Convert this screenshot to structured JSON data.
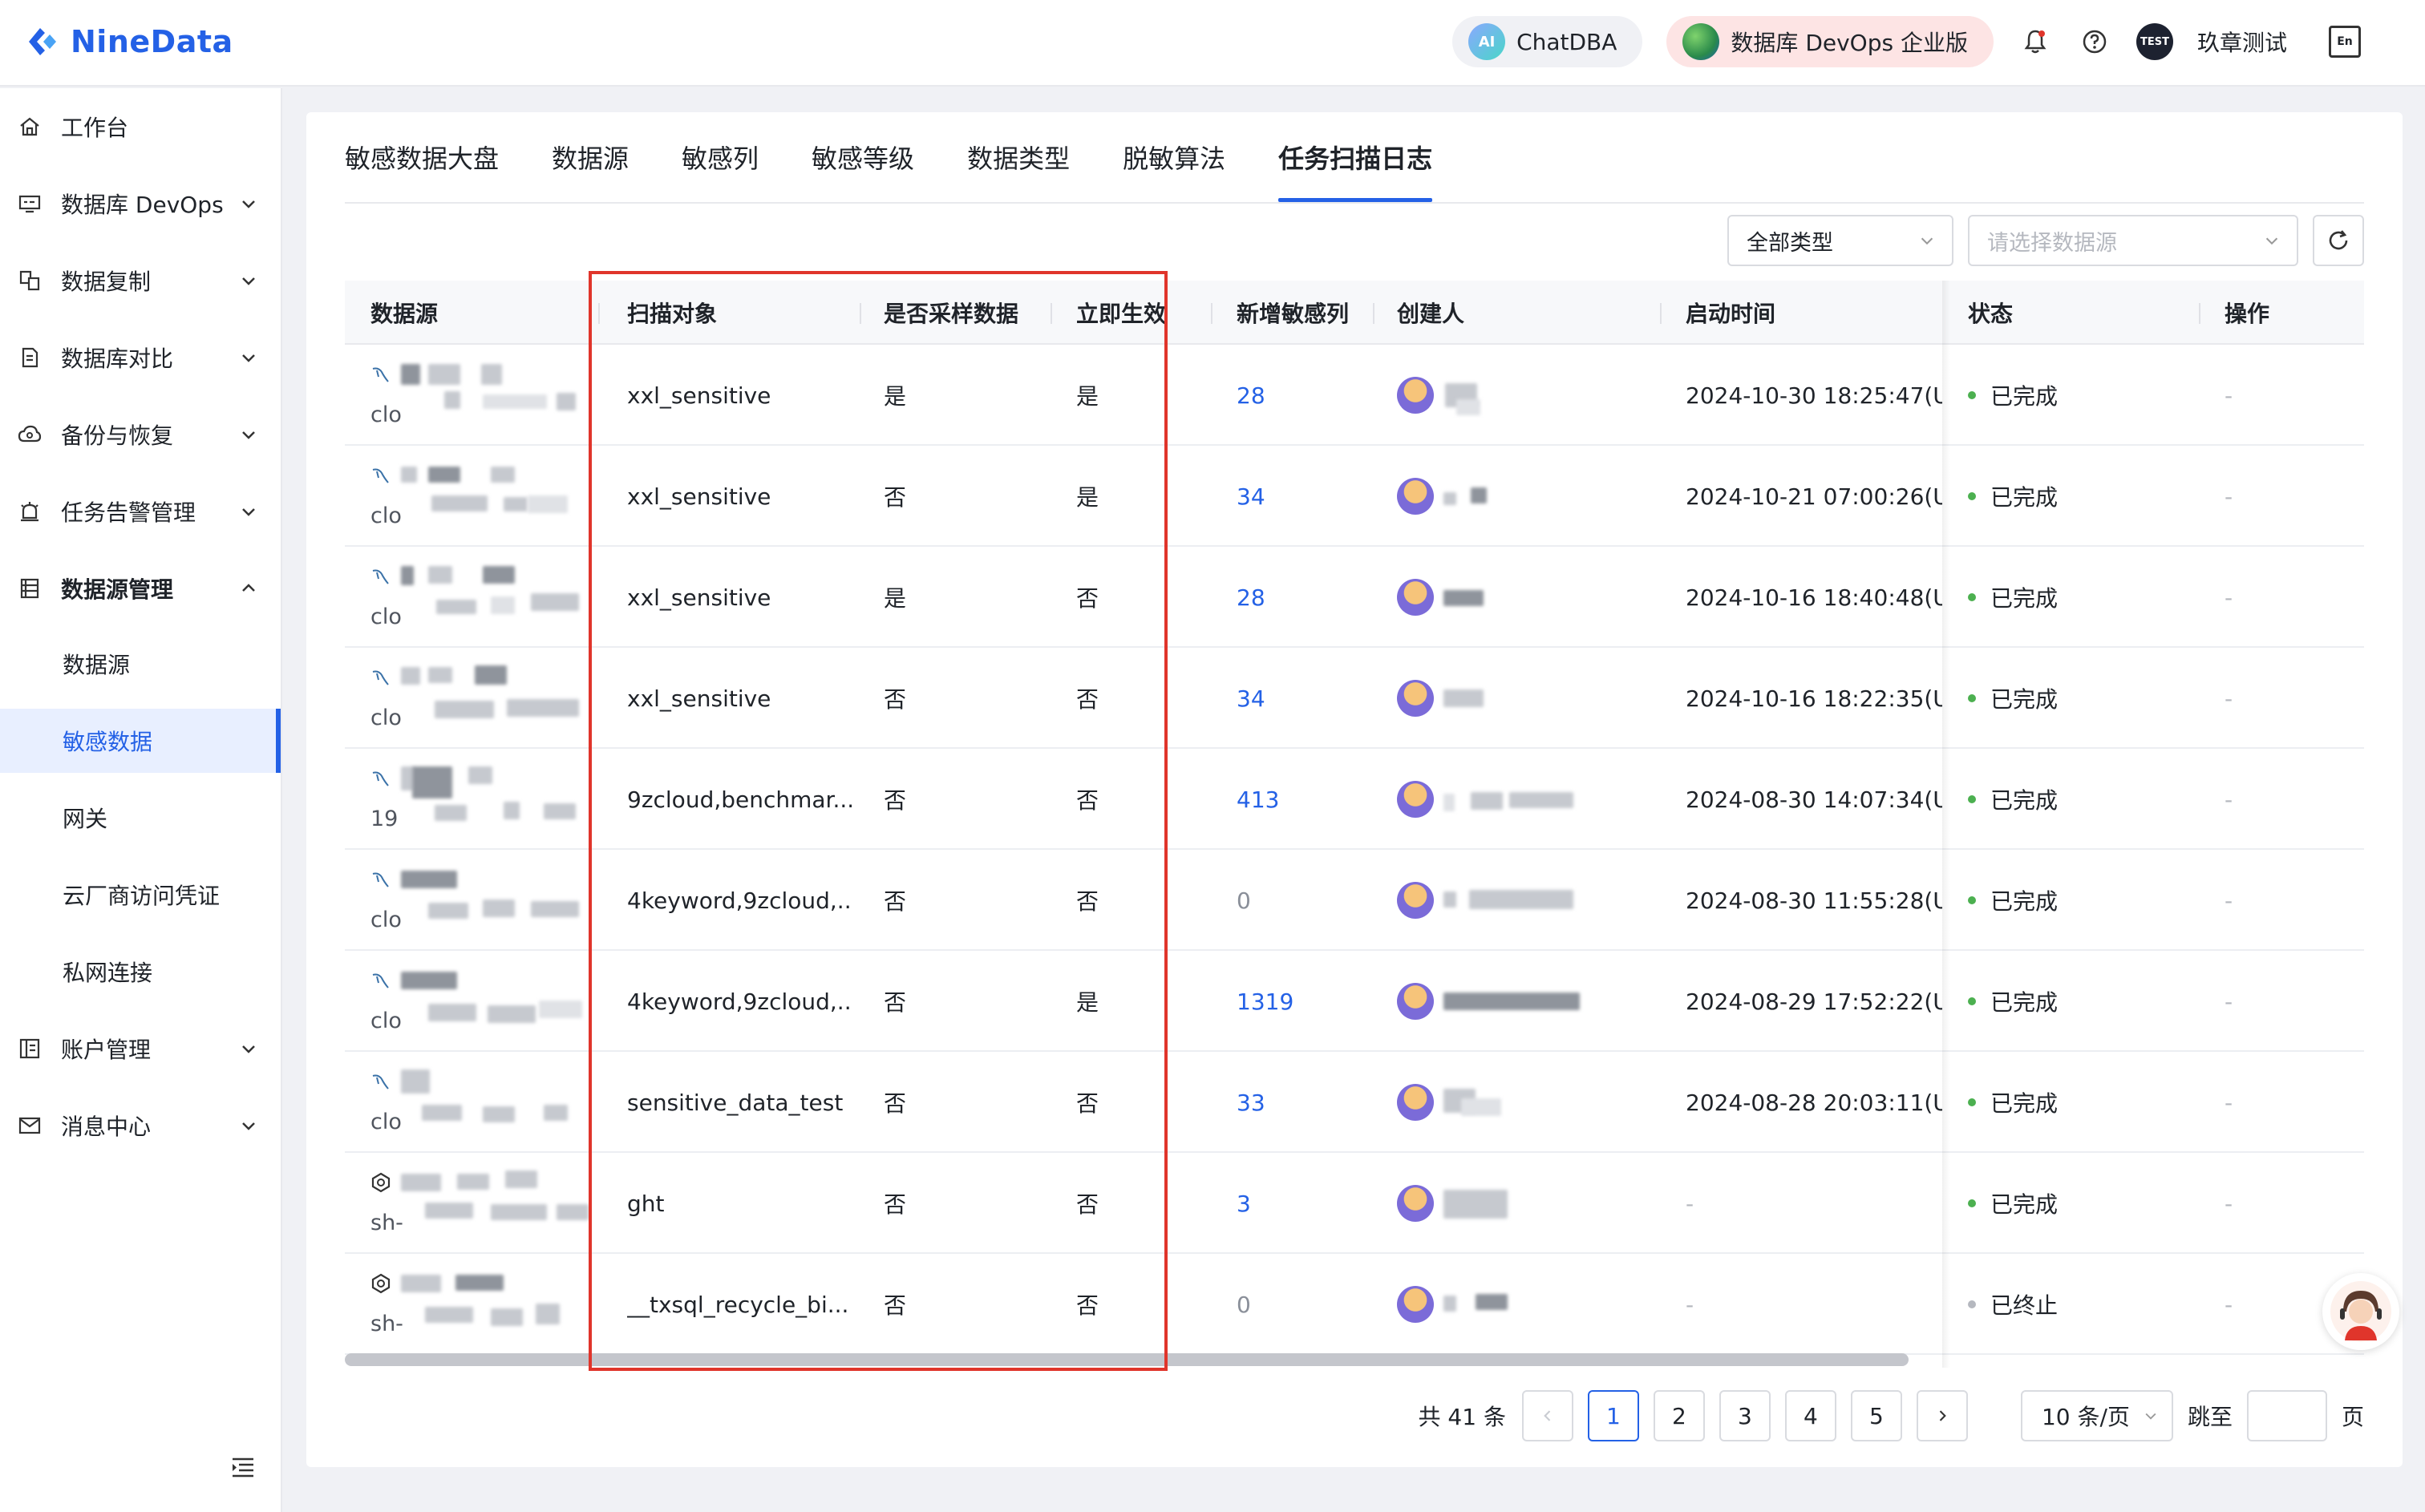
{
  "brand": {
    "name": "NineData"
  },
  "header": {
    "chatdba_label": "ChatDBA",
    "chatdba_badge": "AI",
    "devops_label": "数据库 DevOps 企业版",
    "avatar_text": "TEST",
    "user_name": "玖章测试",
    "lang_label": "En"
  },
  "sidebar": {
    "items": [
      {
        "label": "工作台",
        "icon": "home-icon"
      },
      {
        "label": "数据库 DevOps",
        "icon": "devops-icon"
      },
      {
        "label": "数据复制",
        "icon": "replication-icon"
      },
      {
        "label": "数据库对比",
        "icon": "compare-icon"
      },
      {
        "label": "备份与恢复",
        "icon": "backup-icon"
      },
      {
        "label": "任务告警管理",
        "icon": "alarm-icon"
      },
      {
        "label": "数据源管理",
        "icon": "datasource-icon"
      }
    ],
    "sub_items": [
      "数据源",
      "敏感数据",
      "网关",
      "云厂商访问凭证",
      "私网连接"
    ],
    "bottom_items": [
      {
        "label": "账户管理",
        "icon": "account-icon"
      },
      {
        "label": "消息中心",
        "icon": "mail-icon"
      }
    ]
  },
  "tabs": [
    "敏感数据大盘",
    "数据源",
    "敏感列",
    "敏感等级",
    "数据类型",
    "脱敏算法",
    "任务扫描日志"
  ],
  "filters": {
    "type_select": "全部类型",
    "datasource_placeholder": "请选择数据源"
  },
  "table": {
    "columns": [
      "数据源",
      "扫描对象",
      "是否采样数据",
      "立即生效",
      "新增敏感列",
      "创建人",
      "启动时间",
      "状态",
      "操作"
    ],
    "rows": [
      {
        "ds_prefix": "clo",
        "target": "xxl_sensitive",
        "sample": "是",
        "immediate": "是",
        "new_cols": "28",
        "start": "2024-10-30 18:25:47(U",
        "status": "已完成",
        "op": "-"
      },
      {
        "ds_prefix": "clo",
        "target": "xxl_sensitive",
        "sample": "否",
        "immediate": "是",
        "new_cols": "34",
        "start": "2024-10-21 07:00:26(U",
        "status": "已完成",
        "op": "-"
      },
      {
        "ds_prefix": "clo",
        "target": "xxl_sensitive",
        "sample": "是",
        "immediate": "否",
        "new_cols": "28",
        "start": "2024-10-16 18:40:48(U",
        "status": "已完成",
        "op": "-"
      },
      {
        "ds_prefix": "clo",
        "target": "xxl_sensitive",
        "sample": "否",
        "immediate": "否",
        "new_cols": "34",
        "start": "2024-10-16 18:22:35(U",
        "status": "已完成",
        "op": "-"
      },
      {
        "ds_prefix": "19",
        "target": "9zcloud,benchmar...",
        "sample": "否",
        "immediate": "否",
        "new_cols": "413",
        "start": "2024-08-30 14:07:34(U",
        "status": "已完成",
        "op": "-"
      },
      {
        "ds_prefix": "clo",
        "target": "4keyword,9zcloud,...",
        "sample": "否",
        "immediate": "否",
        "new_cols": "0",
        "start": "2024-08-30 11:55:28(U",
        "status": "已完成",
        "op": "-"
      },
      {
        "ds_prefix": "clo",
        "target": "4keyword,9zcloud,...",
        "sample": "否",
        "immediate": "是",
        "new_cols": "1319",
        "start": "2024-08-29 17:52:22(U",
        "status": "已完成",
        "op": "-"
      },
      {
        "ds_prefix": "clo",
        "target": "sensitive_data_test",
        "sample": "否",
        "immediate": "否",
        "new_cols": "33",
        "start": "2024-08-28 20:03:11(U",
        "status": "已完成",
        "op": "-"
      },
      {
        "ds_prefix": "sh-",
        "target": "ght",
        "sample": "否",
        "immediate": "否",
        "new_cols": "3",
        "start": "-",
        "status": "已完成",
        "op": "-"
      },
      {
        "ds_prefix": "sh-",
        "target": "__txsql_recycle_bi...",
        "sample": "否",
        "immediate": "否",
        "new_cols": "0",
        "start": "-",
        "status": "已终止",
        "op": "-"
      }
    ]
  },
  "pagination": {
    "total": "共 41 条",
    "pages": [
      "1",
      "2",
      "3",
      "4",
      "5"
    ],
    "current": "1",
    "page_size": "10 条/页",
    "jump_label": "跳至",
    "page_unit": "页"
  },
  "colors": {
    "accent": "#2461e6",
    "highlight": "#e0352b",
    "success": "#4cb050"
  }
}
